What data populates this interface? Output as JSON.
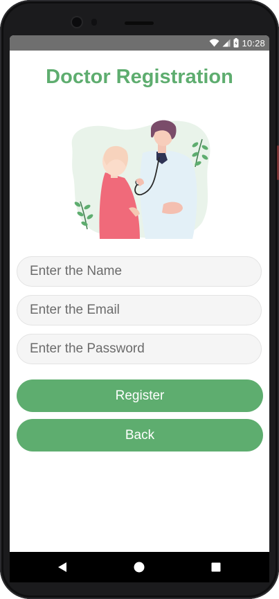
{
  "status_bar": {
    "time": "10:28",
    "icons": [
      "wifi-icon",
      "signal-icon",
      "battery-icon"
    ]
  },
  "page": {
    "title": "Doctor Registration"
  },
  "form": {
    "name_placeholder": "Enter the Name",
    "email_placeholder": "Enter the Email",
    "password_placeholder": "Enter the Password",
    "name_value": "",
    "email_value": "",
    "password_value": ""
  },
  "buttons": {
    "register_label": "Register",
    "back_label": "Back"
  },
  "nav_bar": {
    "icons": [
      "back-triangle-icon",
      "home-circle-icon",
      "recents-square-icon"
    ]
  },
  "colors": {
    "accent": "#5ead6f",
    "status_bar": "#6f6f6f",
    "input_bg": "#f5f5f5"
  }
}
